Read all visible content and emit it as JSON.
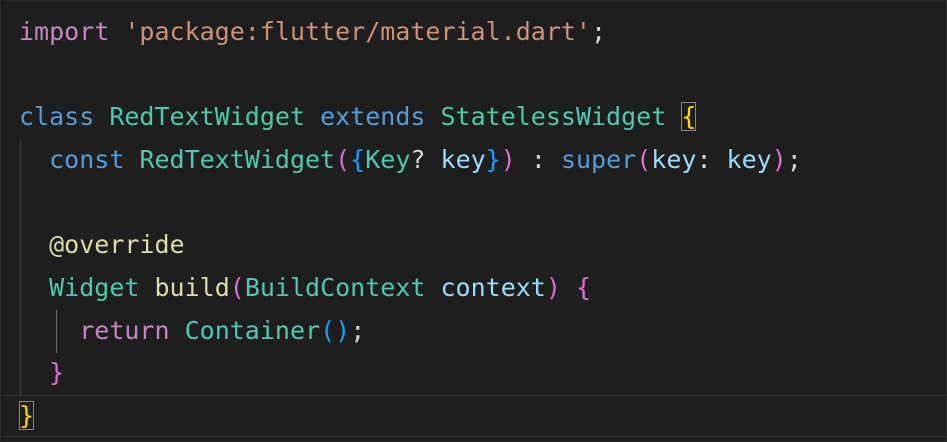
{
  "code": {
    "l1": {
      "import_kw": "import",
      "path": "'package:flutter/material.dart'",
      "semi": ";"
    },
    "l3": {
      "class_kw": "class",
      "name": "RedTextWidget",
      "extends_kw": "extends",
      "base": "StatelessWidget",
      "brace": "{"
    },
    "l4": {
      "const_kw": "const",
      "ctor": "RedTextWidget",
      "paren_open": "(",
      "brace_open": "{",
      "key_type": "Key",
      "nullable": "?",
      "key_param": "key",
      "brace_close": "}",
      "paren_close": ")",
      "colon": " : ",
      "super_kw": "super",
      "sp_open": "(",
      "named_arg": "key",
      "arg_colon": ": ",
      "arg_val": "key",
      "sp_close": ")",
      "semi": ";"
    },
    "l6": {
      "annotation": "@override"
    },
    "l7": {
      "ret_type": "Widget",
      "method": "build",
      "paren_open": "(",
      "param_type": "BuildContext",
      "param_name": "context",
      "paren_close": ")",
      "brace": "{"
    },
    "l8": {
      "return_kw": "return",
      "call": "Container",
      "parens_open": "(",
      "parens_close": ")",
      "semi": ";"
    },
    "l9": {
      "brace": "}"
    },
    "l10": {
      "brace": "}"
    }
  },
  "colors": {
    "background": "#1e1e1e",
    "keyword": "#569cd6",
    "control_keyword": "#c586c0",
    "string": "#ce9178",
    "type": "#4ec9b0",
    "function": "#dcdcaa",
    "variable": "#9cdcfe",
    "bracket_level1": "#ffd700",
    "bracket_level2": "#da70d6",
    "bracket_level3": "#179fff"
  }
}
